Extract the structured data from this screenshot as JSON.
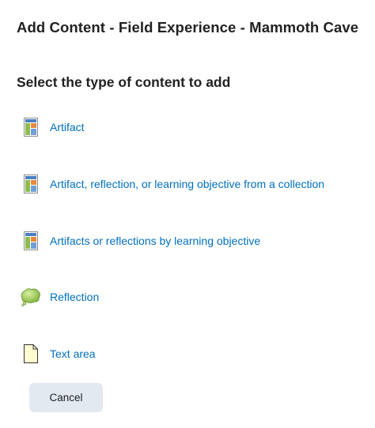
{
  "dialog": {
    "title": "Add Content - Field Experience - Mammoth Cave"
  },
  "section": {
    "heading": "Select the type of content to add"
  },
  "options": [
    {
      "label": "Artifact",
      "icon": "artifact-icon"
    },
    {
      "label": "Artifact, reflection, or learning objective from a collection",
      "icon": "collection-icon"
    },
    {
      "label": "Artifacts or reflections by learning objective",
      "icon": "learning-objective-icon"
    },
    {
      "label": "Reflection",
      "icon": "reflection-icon"
    },
    {
      "label": "Text area",
      "icon": "text-area-icon"
    }
  ],
  "actions": {
    "cancel_label": "Cancel"
  },
  "colors": {
    "link": "#006fbf",
    "heading": "#202122",
    "cancel_bg": "#e3e9f1"
  }
}
